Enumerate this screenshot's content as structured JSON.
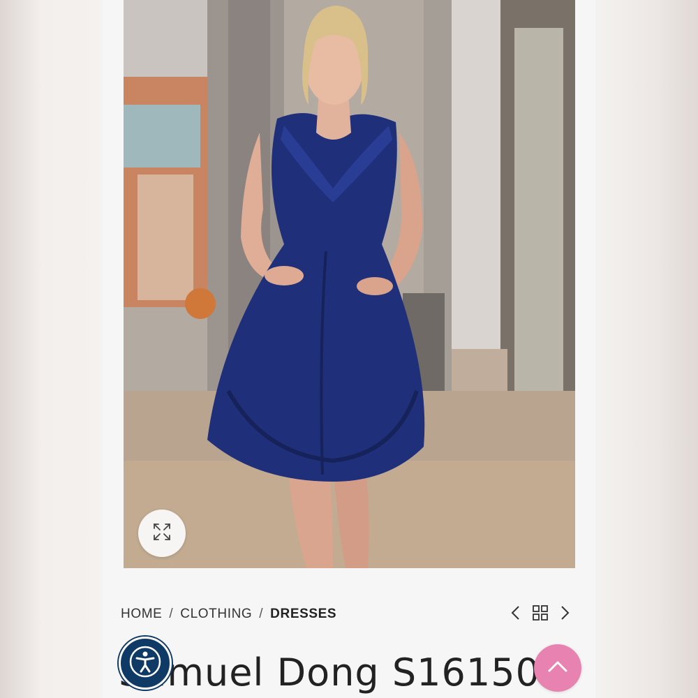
{
  "breadcrumb": {
    "home": "HOME",
    "separator": "/",
    "category": "CLOTHING",
    "current": "DRESSES"
  },
  "product": {
    "title": "Samuel Dong S16150"
  },
  "icons": {
    "zoom": "expand-arrows-icon",
    "prev": "chevron-left-icon",
    "grid": "grid-icon",
    "next": "chevron-right-icon",
    "accessibility": "accessibility-person-icon",
    "back_to_top": "chevron-up-icon"
  },
  "colors": {
    "dress": "#1f2f7a",
    "accessibility_button": "#0f3a66",
    "back_to_top_button": "#e883b1",
    "text": "#222222"
  }
}
